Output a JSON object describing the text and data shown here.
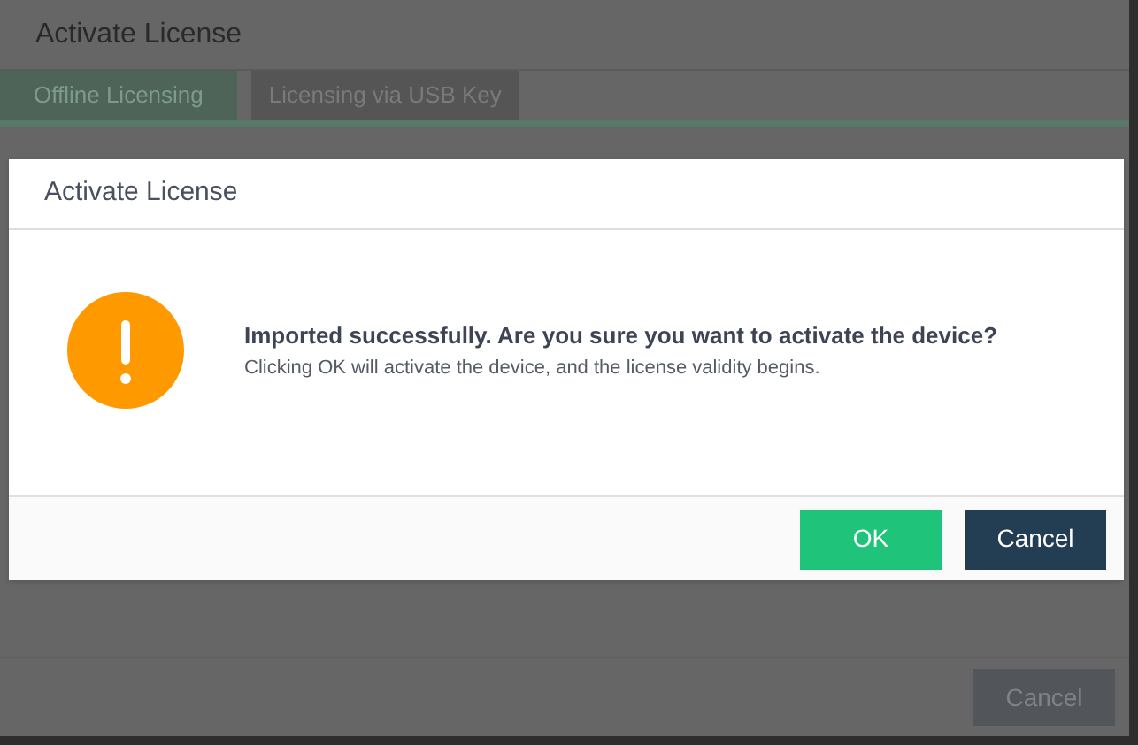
{
  "background_window": {
    "title": "Activate License",
    "tabs": [
      {
        "label": "Offline Licensing",
        "selected": true
      },
      {
        "label": "Licensing via USB Key",
        "selected": false
      }
    ],
    "cancel_button": "Cancel"
  },
  "dialog": {
    "title": "Activate License",
    "heading": "Imported successfully. Are you sure you want to activate the device?",
    "message": "Clicking OK will activate the device, and the license validity begins.",
    "buttons": [
      {
        "label": "OK",
        "kind": "primary"
      },
      {
        "label": "Cancel",
        "kind": "secondary"
      }
    ]
  }
}
